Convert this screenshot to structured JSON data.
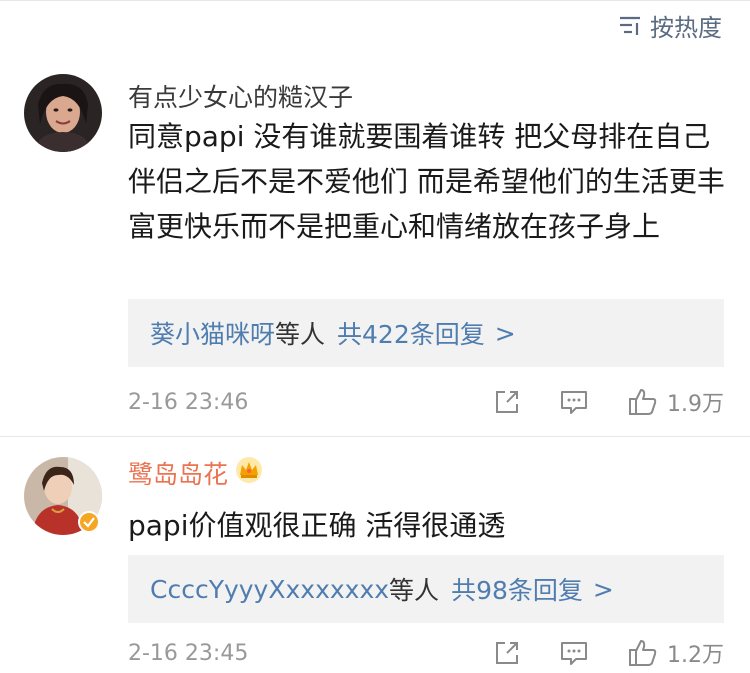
{
  "sort": {
    "label": "按热度"
  },
  "comments": [
    {
      "username": "有点少女心的糙汉子",
      "text": "同意papi 没有谁就要围着谁转 把父母排在自己 伴侣之后不是不爱他们 而是希望他们的生活更丰富更快乐而不是把重心和情绪放在孩子身上",
      "replies": {
        "names": "葵小猫咪呀",
        "etc": "等人",
        "count": "共422条回复",
        "arrow": ">"
      },
      "time": "2-16 23:46",
      "likes": "1.9万"
    },
    {
      "username": "鹭岛岛花",
      "text": "papi价值观很正确 活得很通透",
      "replies": {
        "names": "CcccYyyyXxxxxxxx",
        "etc": "等人",
        "count": "共98条回复",
        "arrow": ">"
      },
      "time": "2-16 23:45",
      "likes": "1.2万"
    }
  ],
  "colors": {
    "link": "#507daf",
    "vip_name": "#eb7350",
    "muted": "#999999"
  },
  "icons": [
    "sort-icon",
    "share-icon",
    "comment-icon",
    "like-icon",
    "crown-icon",
    "verified-badge-icon"
  ]
}
